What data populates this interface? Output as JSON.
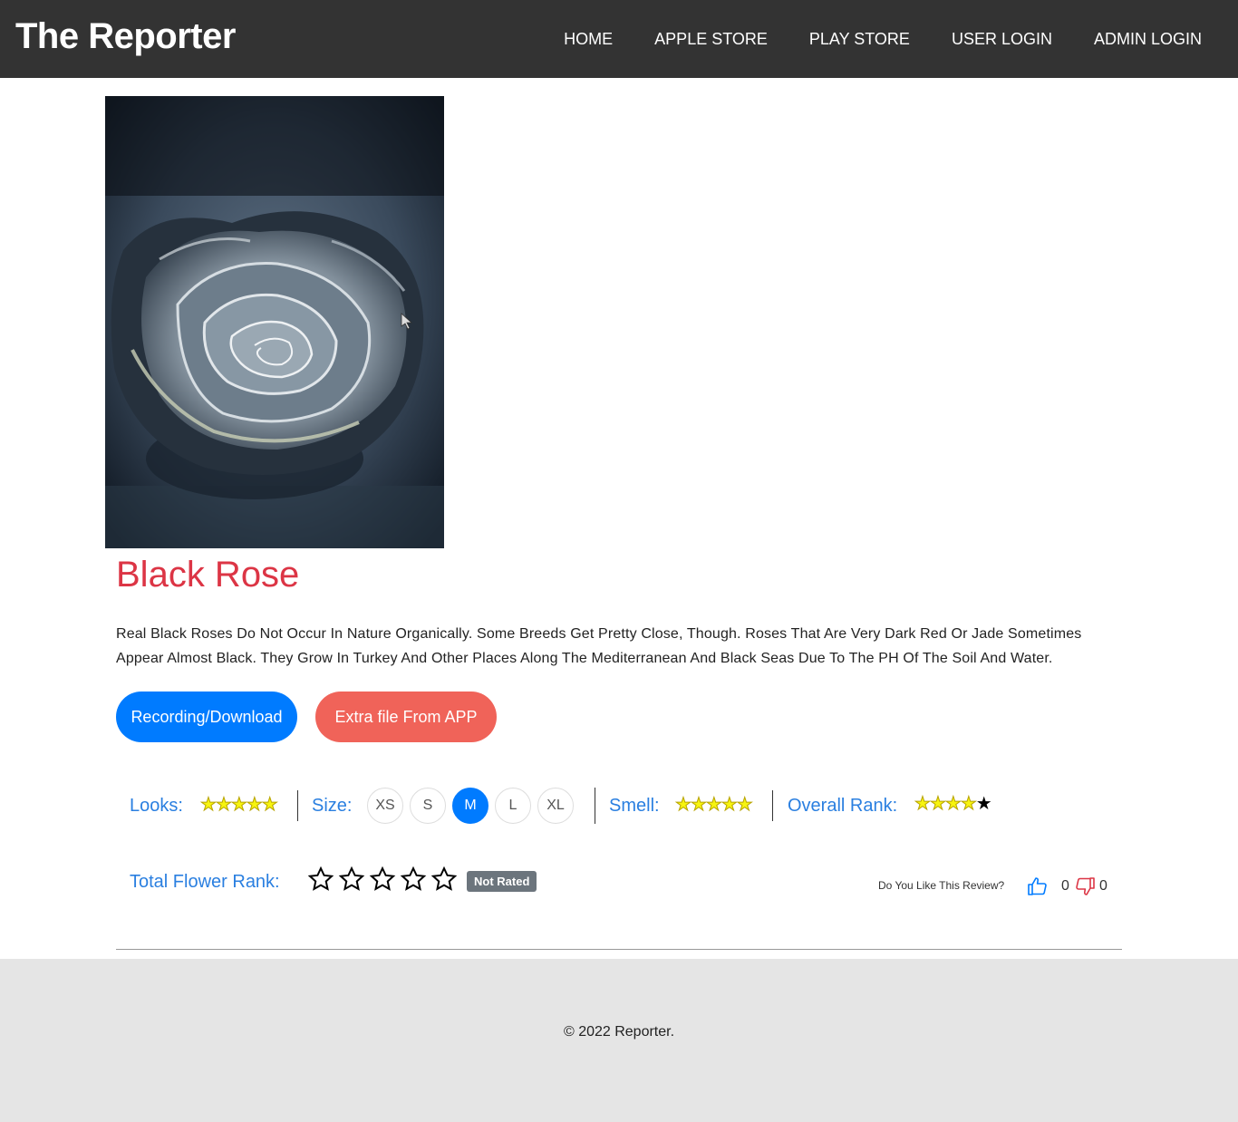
{
  "header": {
    "brand": "The Reporter",
    "nav": [
      "HOME",
      "APPLE STORE",
      "PLAY STORE",
      "USER LOGIN",
      "ADMIN LOGIN"
    ]
  },
  "product": {
    "image_icon": "black-rose-photo",
    "title": "Black Rose",
    "description": "Real Black Roses Do Not Occur In Nature Organically. Some Breeds Get Pretty Close, Though. Roses That Are Very Dark Red Or Jade Sometimes Appear Almost Black. They Grow In Turkey And Other Places Along The Mediterranean And Black Seas Due To The PH Of The Soil And Water."
  },
  "buttons": {
    "recording": "Recording/Download",
    "extra": "Extra file From APP"
  },
  "ratings": {
    "looks_label": "Looks:",
    "looks_value": 5,
    "size_label": "Size:",
    "size_options": [
      "XS",
      "S",
      "M",
      "L",
      "XL"
    ],
    "size_selected": "M",
    "smell_label": "Smell:",
    "smell_value": 5,
    "overall_label": "Overall Rank:",
    "overall_value": 4,
    "max_stars": 5,
    "star_on_color": "#f7f40f",
    "star_off_color": "#000000"
  },
  "total_rank": {
    "label": "Total Flower Rank:",
    "value": 0,
    "badge": "Not Rated"
  },
  "feedback": {
    "question": "Do You Like This Review?",
    "likes": "0",
    "dislikes": "0",
    "like_color": "#007bff",
    "dislike_color": "#dc3545"
  },
  "footer": {
    "copyright": "© 2022 Reporter."
  }
}
